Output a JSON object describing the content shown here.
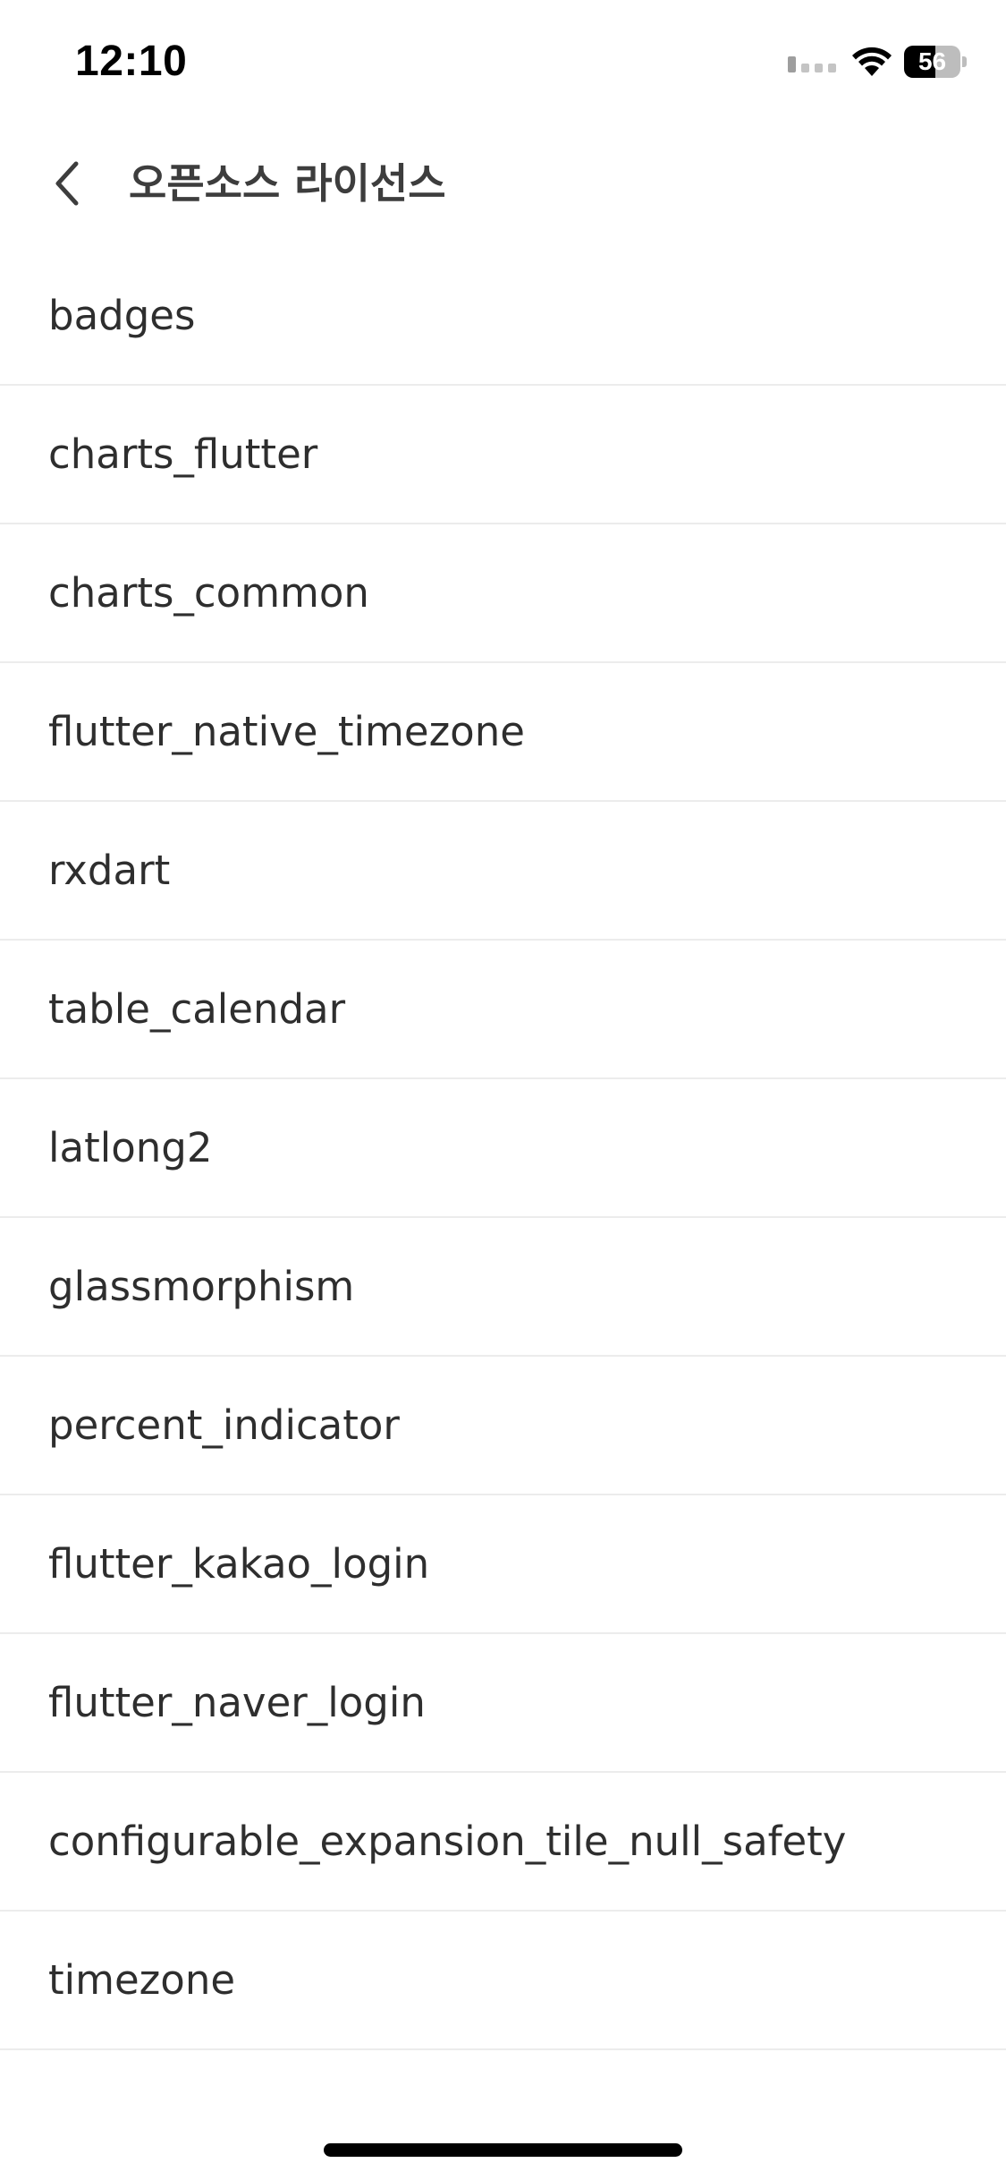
{
  "status_bar": {
    "time": "12:10",
    "battery_level": "56",
    "battery_fraction": 0.56,
    "icons": [
      "signal-icon",
      "wifi-icon",
      "battery-icon"
    ]
  },
  "nav": {
    "back_icon": "chevron-left-icon",
    "title": "오픈소스 라이선스"
  },
  "licenses": [
    {
      "label": "badges"
    },
    {
      "label": "charts_flutter"
    },
    {
      "label": "charts_common"
    },
    {
      "label": "flutter_native_timezone"
    },
    {
      "label": "rxdart"
    },
    {
      "label": "table_calendar"
    },
    {
      "label": "latlong2"
    },
    {
      "label": "glassmorphism"
    },
    {
      "label": "percent_indicator"
    },
    {
      "label": "flutter_kakao_login"
    },
    {
      "label": "flutter_naver_login"
    },
    {
      "label": "configurable_expansion_tile_null_safety"
    },
    {
      "label": "timezone"
    }
  ],
  "colors": {
    "background": "#ffffff",
    "divider": "#ececec",
    "title_text": "#3d3d3d",
    "item_text": "#2e2e2e"
  }
}
